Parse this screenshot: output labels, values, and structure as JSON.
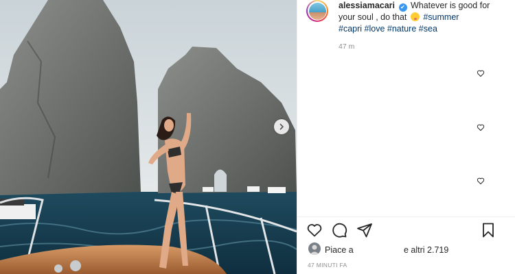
{
  "post": {
    "username": "alessiamacari",
    "caption_text_1": "Whatever is good for your soul , do that",
    "hashtags": [
      "#summer",
      "#capri",
      "#love",
      "#nature",
      "#sea"
    ],
    "time_short": "47 m",
    "liked_by_text": "Piace a",
    "likes_others": "e altri 2.719",
    "posted_ago": "47 MINUTI FA"
  },
  "icons": {
    "verified": "✔",
    "next": "chevron-right-icon",
    "like": "heart-icon",
    "comment": "comment-icon",
    "share": "paper-plane-icon",
    "save": "bookmark-icon"
  },
  "colors": {
    "hashtag": "#00376b",
    "verified": "#3897f0",
    "muted": "#8e8e8e"
  }
}
